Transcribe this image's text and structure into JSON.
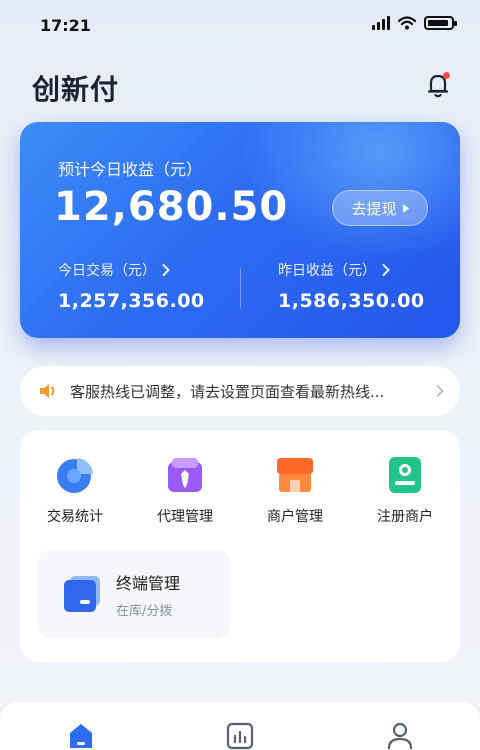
{
  "status_bar": {
    "time": "17:21"
  },
  "header": {
    "app_title": "创新付"
  },
  "earnings": {
    "today_estimate_label": "预计今日收益（元）",
    "today_estimate_value": "12,680.50",
    "withdraw_label": "去提现",
    "today_trade_label": "今日交易（元）",
    "today_trade_value": "1,257,356.00",
    "yesterday_label": "昨日收益（元）",
    "yesterday_value": "1,586,350.00"
  },
  "notice": {
    "text": "客服热线已调整，请去设置页面查看最新热线..."
  },
  "menu": {
    "items": [
      {
        "label": "交易统计",
        "icon": "pie-chart-icon"
      },
      {
        "label": "代理管理",
        "icon": "agent-icon"
      },
      {
        "label": "商户管理",
        "icon": "store-icon"
      },
      {
        "label": "注册商户",
        "icon": "register-merchant-icon"
      }
    ],
    "terminal": {
      "title": "终端管理",
      "subtitle": "在库/分拨",
      "icon": "terminal-icon"
    }
  },
  "tabbar": {
    "tabs": [
      "home-icon",
      "stats-icon",
      "profile-icon"
    ]
  },
  "colors": {
    "primary": "#2e6cf2",
    "notification_dot": "#ff4d4f"
  }
}
